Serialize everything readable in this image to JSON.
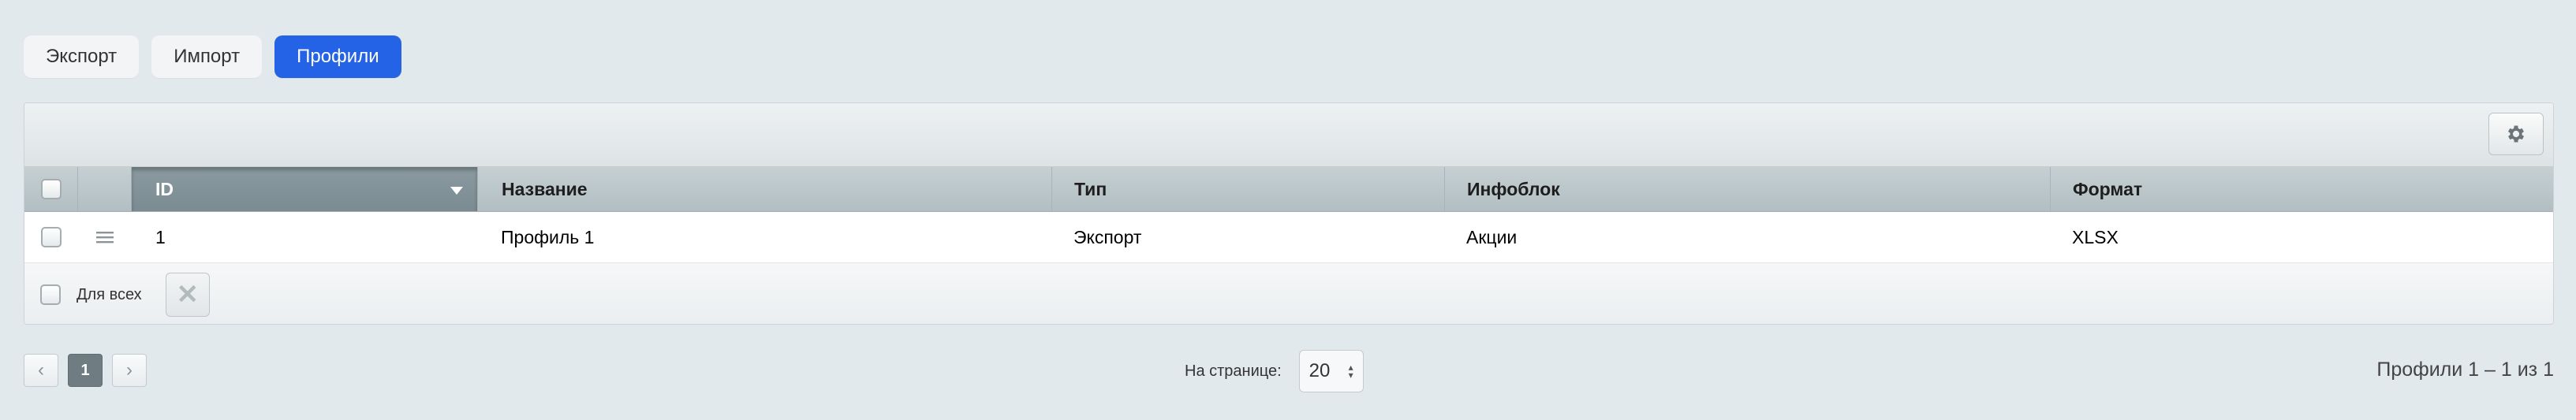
{
  "tabs": [
    {
      "label": "Экспорт",
      "active": false
    },
    {
      "label": "Импорт",
      "active": false
    },
    {
      "label": "Профили",
      "active": true
    }
  ],
  "table": {
    "columns": {
      "id": "ID",
      "name": "Название",
      "type": "Тип",
      "iblock": "Инфоблок",
      "format": "Формат"
    },
    "rows": [
      {
        "id": "1",
        "name": "Профиль 1",
        "type": "Экспорт",
        "iblock": "Акции",
        "format": "XLSX"
      }
    ],
    "footer": {
      "for_all_label": "Для всех",
      "delete_icon": "✕"
    }
  },
  "pagination": {
    "prev_icon": "‹",
    "current_page": "1",
    "next_icon": "›",
    "per_page_label": "На странице:",
    "per_page_value": "20",
    "summary": "Профили 1 – 1 из 1"
  },
  "icons": {
    "settings": "gear-icon",
    "drag": "drag-handle-icon",
    "sort": "sort-desc-icon"
  },
  "colors": {
    "accent": "#2463e5",
    "sorted_header": "#7f9096"
  }
}
